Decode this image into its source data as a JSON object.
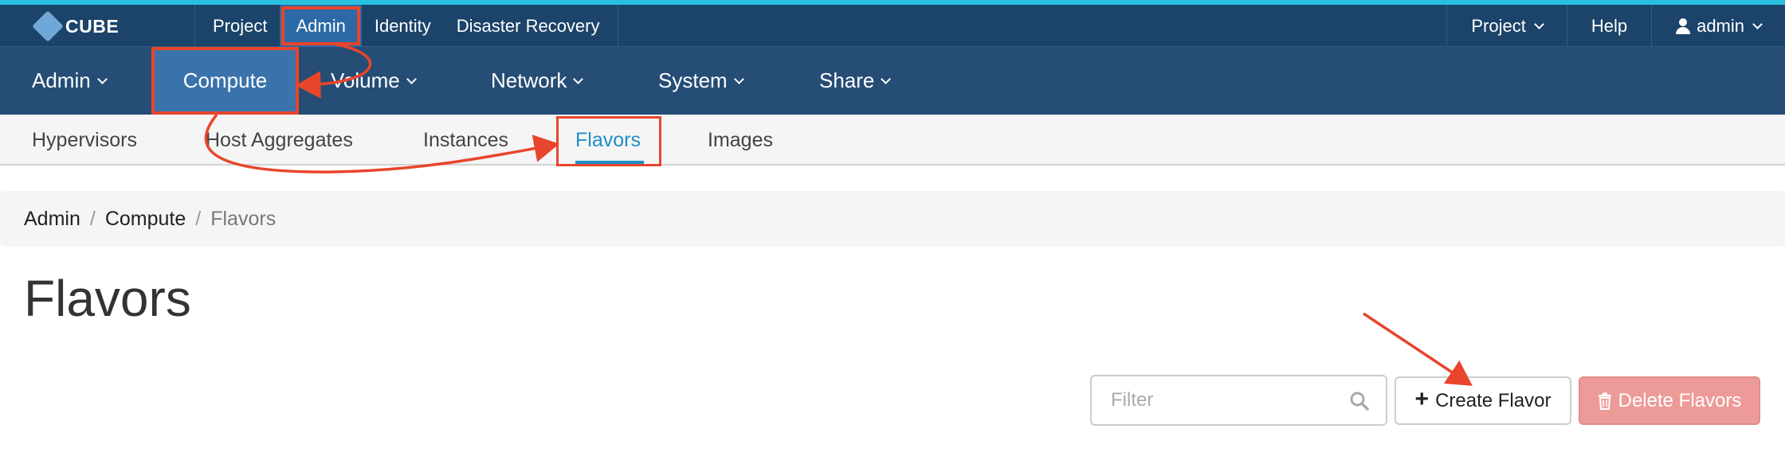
{
  "brand": {
    "name": "CUBE"
  },
  "topbar": {
    "left_items": [
      {
        "label": "Project"
      },
      {
        "label": "Admin"
      },
      {
        "label": "Identity"
      },
      {
        "label": "Disaster Recovery"
      }
    ],
    "right_items": {
      "project": "Project",
      "help": "Help",
      "user": "admin"
    }
  },
  "mainnav": {
    "items": [
      {
        "label": "Admin"
      },
      {
        "label": "Compute"
      },
      {
        "label": "Volume"
      },
      {
        "label": "Network"
      },
      {
        "label": "System"
      },
      {
        "label": "Share"
      }
    ]
  },
  "subnav": {
    "items": [
      {
        "label": "Hypervisors"
      },
      {
        "label": "Host Aggregates"
      },
      {
        "label": "Instances"
      },
      {
        "label": "Flavors"
      },
      {
        "label": "Images"
      }
    ]
  },
  "breadcrumb": {
    "items": [
      "Admin",
      "Compute",
      "Flavors"
    ],
    "separator": "/"
  },
  "page": {
    "title": "Flavors"
  },
  "toolbar": {
    "filter_placeholder": "Filter",
    "create_label": "Create Flavor",
    "delete_label": "Delete Flavors"
  },
  "colors": {
    "topbar": "#1c4369",
    "mainnav": "#254d75",
    "active_nav": "#3a73ab",
    "accent_link": "#1f8ec8",
    "annotation": "#e8452c",
    "danger_button": "#ed9b98"
  }
}
